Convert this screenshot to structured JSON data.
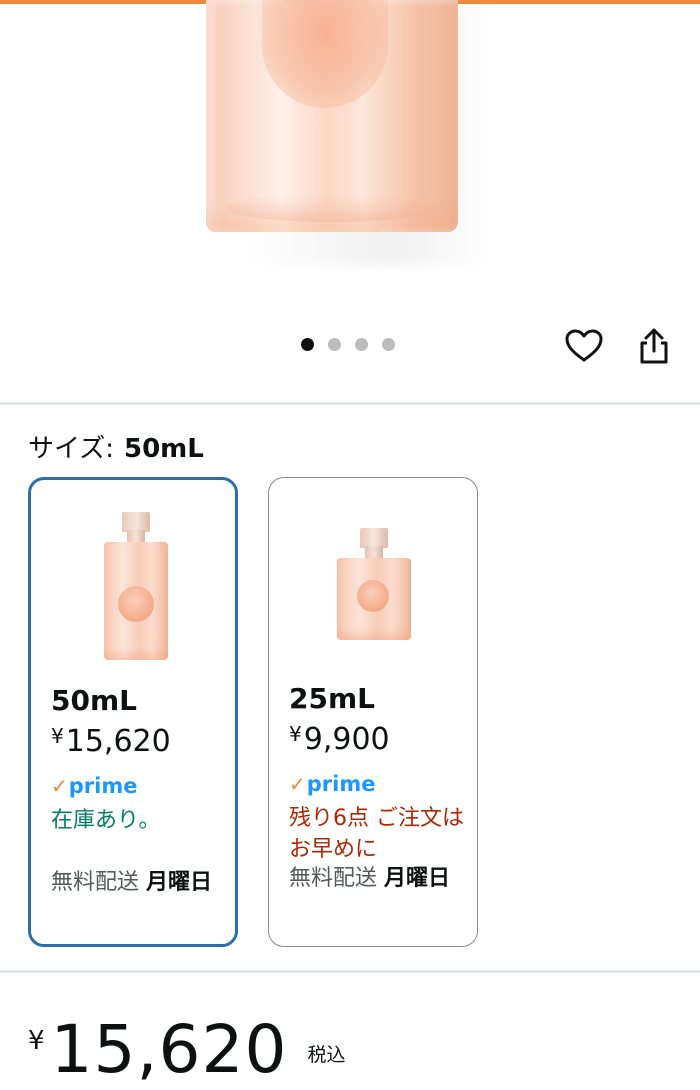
{
  "gallery": {
    "dots_count": 4,
    "active_dot": 1,
    "icons": [
      "heart-icon",
      "share-icon"
    ]
  },
  "size_selector": {
    "label": "サイズ:",
    "selected_value": "50mL"
  },
  "options": [
    {
      "size": "50mL",
      "currency": "¥",
      "price": "15,620",
      "prime_label": "prime",
      "stock": "在庫あり。",
      "delivery_prefix": "無料配送",
      "delivery_day": "月曜日",
      "selected": true
    },
    {
      "size": "25mL",
      "currency": "¥",
      "price": "9,900",
      "prime_label": "prime",
      "stock": "残り6点 ご注文はお早めに",
      "delivery_prefix": "無料配送",
      "delivery_day": "月曜日",
      "selected": false
    }
  ],
  "price_block": {
    "currency": "¥",
    "amount": "15,620",
    "tax_label": "税込"
  },
  "colors": {
    "accent_top": "#f08a3a",
    "selected_border": "#2a6eae",
    "in_stock": "#067d62",
    "low_stock": "#b12704",
    "prime_blue": "#1a98ff"
  }
}
